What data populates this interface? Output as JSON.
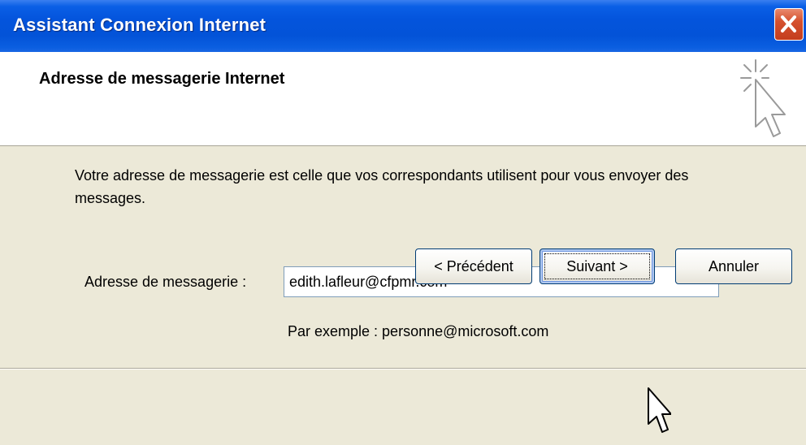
{
  "window": {
    "title": "Assistant Connexion Internet"
  },
  "header": {
    "title": "Adresse de messagerie Internet",
    "icon": "wizard-sparkle-cursor-icon"
  },
  "body": {
    "description": "Votre adresse de messagerie est celle que vos correspondants utilisent pour vous envoyer des messages.",
    "email_label": "Adresse de messagerie :",
    "email_value": "edith.lafleur@cfpmr.com",
    "example": "Par exemple : personne@microsoft.com"
  },
  "buttons": {
    "previous": "< Précédent",
    "next": "Suivant >",
    "cancel": "Annuler"
  },
  "colors": {
    "titlebar": "#0454dc",
    "close_button": "#d5512f",
    "dialog_background": "#ece9d8"
  }
}
